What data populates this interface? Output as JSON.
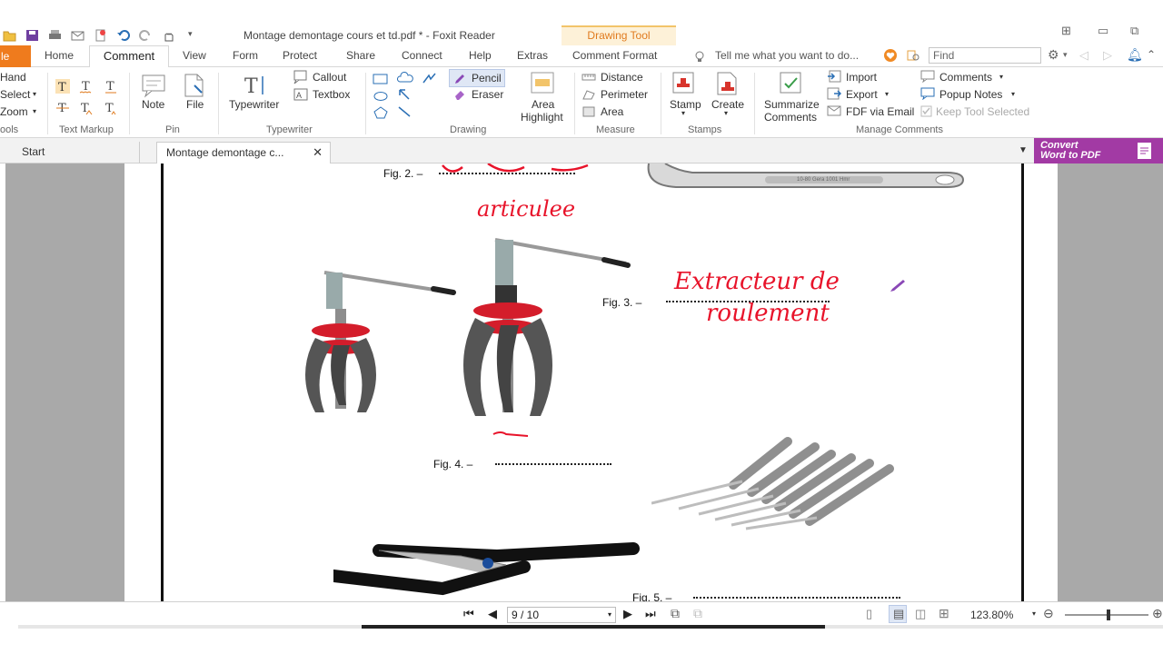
{
  "window": {
    "title": "Montage demontage cours et td.pdf * - Foxit Reader",
    "context_tab": "Drawing Tool"
  },
  "menu_tabs": {
    "file": "le",
    "home": "Home",
    "comment": "Comment",
    "view": "View",
    "form": "Form",
    "protect": "Protect",
    "share": "Share",
    "connect": "Connect",
    "help": "Help",
    "extras": "Extras",
    "comment_format": "Comment Format"
  },
  "tell_me_placeholder": "Tell me what you want to do...",
  "find_placeholder": "Find",
  "ribbon": {
    "tools": {
      "hand": "Hand",
      "select": "Select",
      "zoom": "Zoom",
      "group": "ools"
    },
    "text_markup": {
      "group": "Text Markup"
    },
    "pin": {
      "note": "Note",
      "file": "File",
      "group": "Pin"
    },
    "typewriter": {
      "typewriter": "Typewriter",
      "callout": "Callout",
      "textbox": "Textbox",
      "group": "Typewriter"
    },
    "drawing": {
      "pencil": "Pencil",
      "eraser": "Eraser",
      "area_highlight_1": "Area",
      "area_highlight_2": "Highlight",
      "group": "Drawing"
    },
    "measure": {
      "distance": "Distance",
      "perimeter": "Perimeter",
      "area": "Area",
      "group": "Measure"
    },
    "stamps": {
      "stamp": "Stamp",
      "create": "Create",
      "group": "Stamps"
    },
    "manage": {
      "summarize_1": "Summarize",
      "summarize_2": "Comments",
      "import": "Import",
      "export": "Export",
      "fdf": "FDF via Email",
      "comments": "Comments",
      "popup_notes": "Popup Notes",
      "keep_tool": "Keep Tool Selected",
      "group": "Manage Comments"
    }
  },
  "convert": {
    "line1": "Convert",
    "line2": "Word to PDF"
  },
  "doc_tabs": {
    "start": "Start",
    "active": "Montage demontage c..."
  },
  "document": {
    "fig2": "Fig. 2. –",
    "fig3": "Fig. 3. –",
    "fig4": "Fig. 4. –",
    "fig5": "Fig. 5. –",
    "wrench_marking": "10-80   Gera 1001 Hmr"
  },
  "status": {
    "page": "9 / 10",
    "zoom": "123.80%"
  },
  "colors": {
    "accent": "#ef7b1d",
    "convert": "#a23aa4",
    "annotation_red": "#e8132a",
    "active_tool": "#dfe7f5"
  }
}
